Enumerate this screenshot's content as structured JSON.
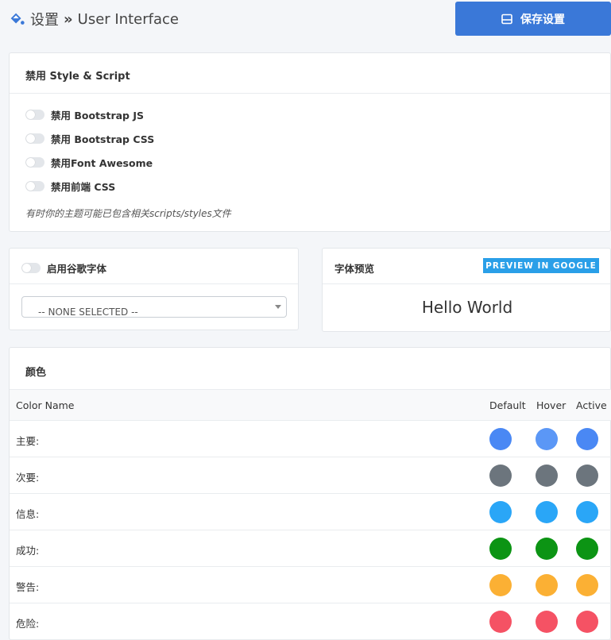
{
  "header": {
    "breadcrumb_root": "设置",
    "breadcrumb_current": "User Interface",
    "save_label": "保存设置"
  },
  "style_script": {
    "title": "禁用 Style & Script",
    "toggles": [
      "禁用 Bootstrap JS",
      "禁用 Bootstrap CSS",
      "禁用Font Awesome",
      "禁用前端 CSS"
    ],
    "note": "有时你的主题可能已包含相关scripts/styles文件"
  },
  "google_font": {
    "toggle_label": "启用谷歌字体",
    "select_value": "-- NONE SELECTED --"
  },
  "font_preview": {
    "title": "字体预览",
    "button_label": "PREVIEW IN GOOGLE",
    "sample_text": "Hello World"
  },
  "colors": {
    "title": "颜色",
    "columns": [
      "Color Name",
      "Default",
      "Hover",
      "Active"
    ],
    "rows": [
      {
        "name": "主要:",
        "default": "#4a88f4",
        "hover": "#5b97f6",
        "active": "#4a88f4"
      },
      {
        "name": "次要:",
        "default": "#6c757d",
        "hover": "#6c757d",
        "active": "#6c757d"
      },
      {
        "name": "信息:",
        "default": "#2aa6f7",
        "hover": "#2aa6f7",
        "active": "#2aa6f7"
      },
      {
        "name": "成功:",
        "default": "#0c9414",
        "hover": "#0c9414",
        "active": "#0c9414"
      },
      {
        "name": "警告:",
        "default": "#fbb034",
        "hover": "#fbb034",
        "active": "#fbb034"
      },
      {
        "name": "危险:",
        "default": "#f55264",
        "hover": "#f55264",
        "active": "#f55264"
      }
    ]
  },
  "theme": {
    "accent": "#3a78d8",
    "preview_button": "#2a9fe8"
  }
}
